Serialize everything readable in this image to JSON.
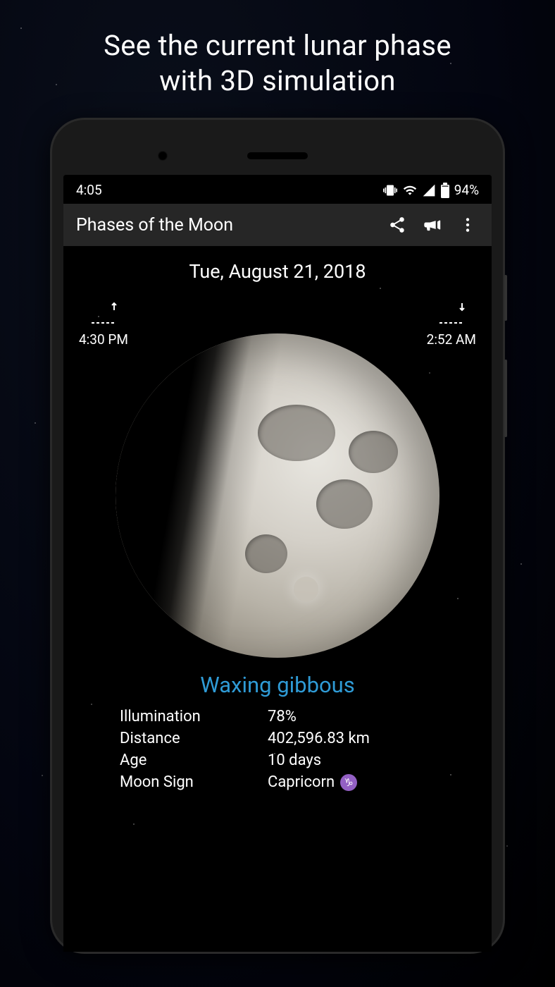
{
  "promo": {
    "line1": "See the current lunar phase",
    "line2": "with 3D simulation"
  },
  "status_bar": {
    "time": "4:05",
    "battery_pct": "94%"
  },
  "app_bar": {
    "title": "Phases of the Moon"
  },
  "content": {
    "date": "Tue, August 21, 2018",
    "moonrise": "4:30 PM",
    "moonset": "2:52 AM",
    "phase_name": "Waxing gibbous",
    "stats": {
      "illumination_label": "Illumination",
      "illumination_value": "78%",
      "distance_label": "Distance",
      "distance_value": "402,596.83 km",
      "age_label": "Age",
      "age_value": "10 days",
      "moon_sign_label": "Moon Sign",
      "moon_sign_value": "Capricorn",
      "moon_sign_glyph": "♑︎"
    }
  }
}
